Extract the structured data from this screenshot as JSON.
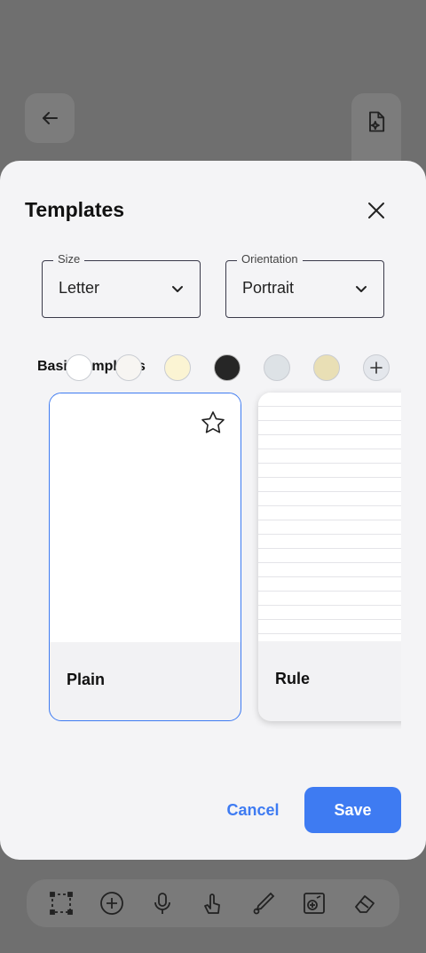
{
  "colors": {
    "accent": "#3e7bf2",
    "overlay": "#6f6f6f",
    "sheet_bg": "#f4f4f6"
  },
  "background": {
    "back_icon": "arrow-left-icon",
    "ai_icon": "document-sparkle-icon",
    "toolbar_icons": [
      "select-rect-icon",
      "add-circle-icon",
      "microphone-icon",
      "hand-draw-icon",
      "pen-tool-icon",
      "image-edit-icon",
      "eraser-icon"
    ]
  },
  "sheet": {
    "title": "Templates",
    "size": {
      "label": "Size",
      "value": "Letter"
    },
    "orientation": {
      "label": "Orientation",
      "value": "Portrait"
    },
    "section_label": "Basic templates",
    "swatches": [
      "#ffffff",
      "#f7f5f2",
      "#fbf4d3",
      "#262626",
      "#dde2e6",
      "#e9dfb5",
      "add"
    ],
    "templates": [
      {
        "name": "Plain",
        "selected": true,
        "starred": false
      },
      {
        "name": "Rule",
        "selected": false
      }
    ],
    "cancel_label": "Cancel",
    "save_label": "Save"
  }
}
